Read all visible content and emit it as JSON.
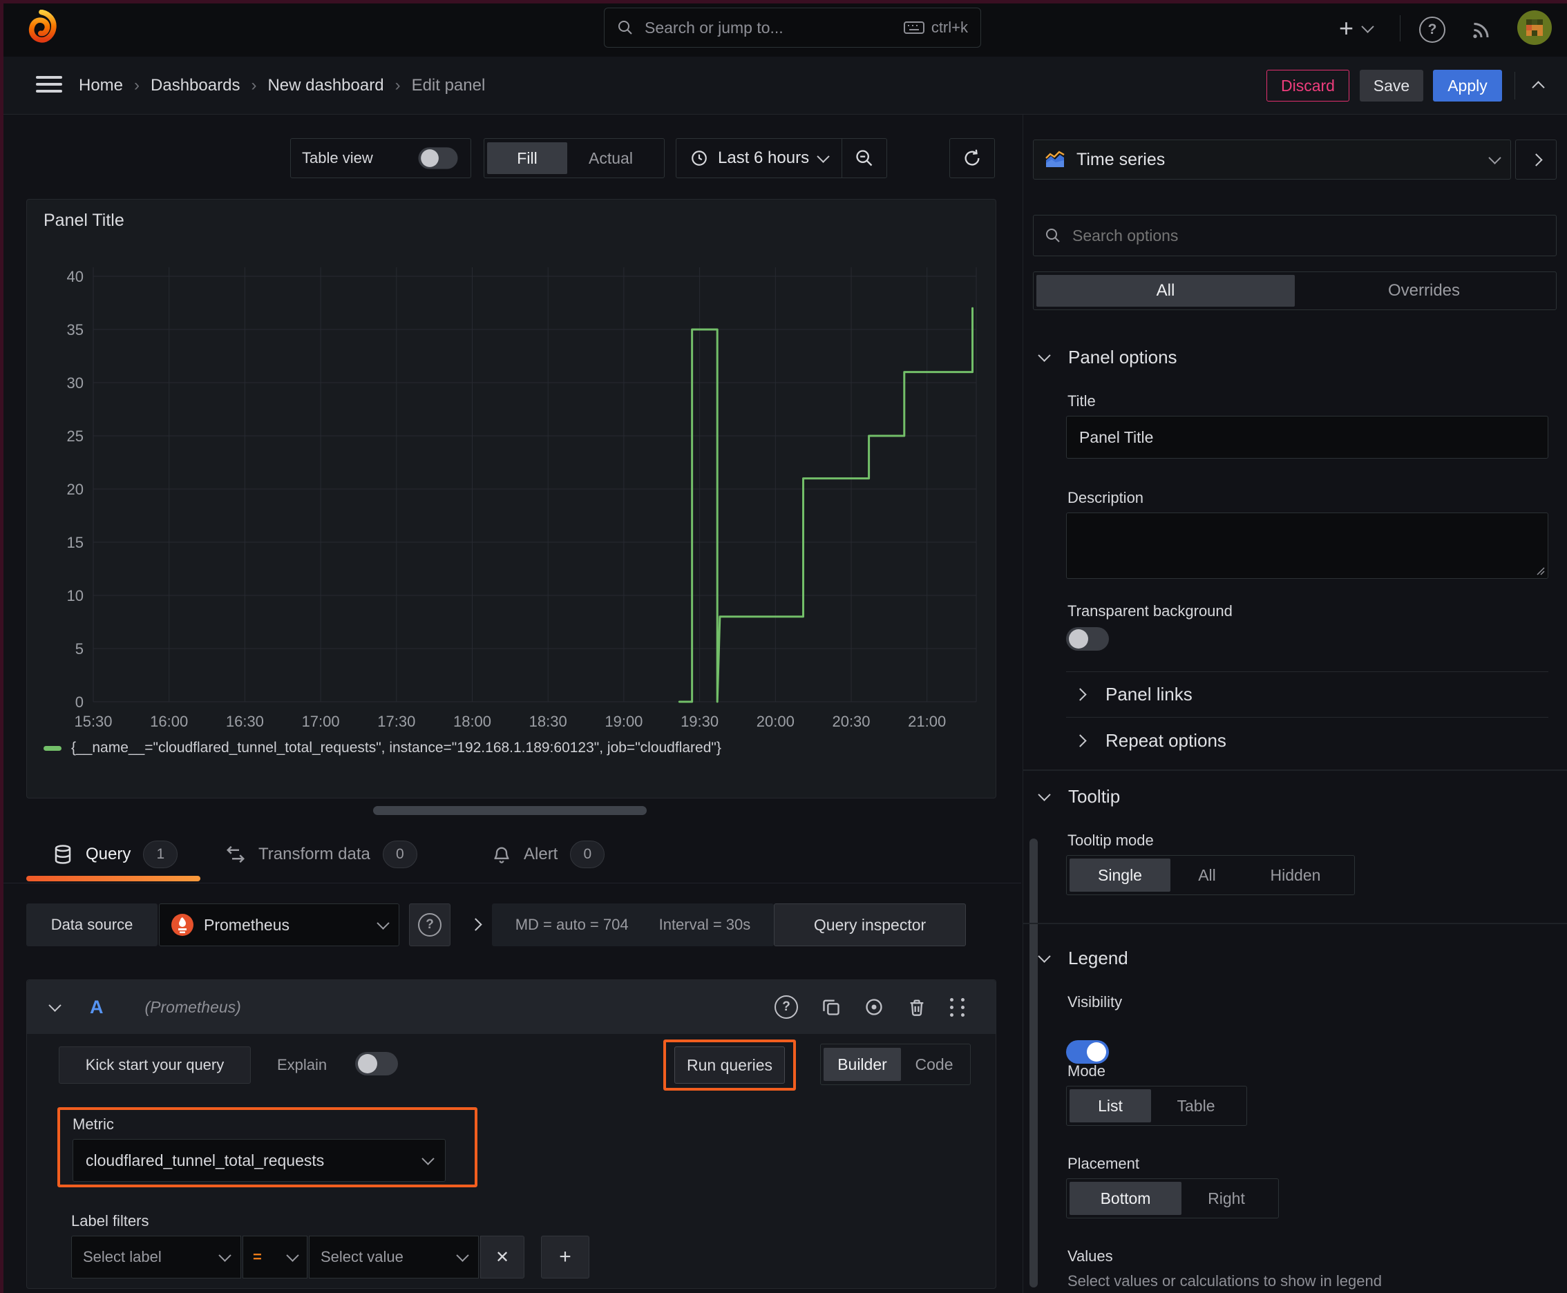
{
  "topbar": {
    "search_placeholder": "Search or jump to...",
    "shortcut": "ctrl+k"
  },
  "breadcrumb": {
    "items": [
      "Home",
      "Dashboards",
      "New dashboard",
      "Edit panel"
    ]
  },
  "actions": {
    "discard": "Discard",
    "save": "Save",
    "apply": "Apply"
  },
  "toolbar": {
    "table_view": "Table view",
    "fill": "Fill",
    "actual": "Actual",
    "time_range": "Last 6 hours"
  },
  "chart_data": {
    "type": "line",
    "title": "Panel Title",
    "x_ticks": [
      "15:30",
      "16:00",
      "16:30",
      "17:00",
      "17:30",
      "18:00",
      "18:30",
      "19:00",
      "19:30",
      "20:00",
      "20:30",
      "21:00"
    ],
    "ylim": [
      0,
      40
    ],
    "y_step": 5,
    "grid": true,
    "legend_position": "bottom",
    "line_interpolation": "step",
    "series": [
      {
        "name": "{__name__=\"cloudflared_tunnel_total_requests\", instance=\"192.168.1.189:60123\", job=\"cloudflared\"}",
        "color": "#73bf69",
        "points": [
          [
            "19:22",
            0
          ],
          [
            "19:27",
            0
          ],
          [
            "19:27",
            35
          ],
          [
            "19:37",
            35
          ],
          [
            "19:37",
            0
          ],
          [
            "19:38",
            8
          ],
          [
            "20:11",
            8
          ],
          [
            "20:11",
            21
          ],
          [
            "20:37",
            21
          ],
          [
            "20:37",
            25
          ],
          [
            "20:51",
            25
          ],
          [
            "20:51",
            31
          ],
          [
            "21:18",
            31
          ],
          [
            "21:18",
            37
          ]
        ]
      }
    ]
  },
  "tabs": [
    {
      "label": "Query",
      "badge": "1"
    },
    {
      "label": "Transform data",
      "badge": "0"
    },
    {
      "label": "Alert",
      "badge": "0"
    }
  ],
  "query": {
    "datasource_label": "Data source",
    "datasource": "Prometheus",
    "info": {
      "max_data_points": "MD = auto = 704",
      "interval": "Interval = 30s"
    },
    "inspector": "Query inspector",
    "row": {
      "ref": "A",
      "ds_hint": "(Prometheus)"
    },
    "kickstart": "Kick start your query",
    "explain": "Explain",
    "run": "Run queries",
    "builder": "Builder",
    "code": "Code",
    "metric": {
      "label": "Metric",
      "value": "cloudflared_tunnel_total_requests"
    },
    "label_filters": {
      "label": "Label filters",
      "select_label": "Select label",
      "operator": "=",
      "select_value": "Select value"
    }
  },
  "options": {
    "viz": "Time series",
    "search_placeholder": "Search options",
    "filter_tabs": [
      "All",
      "Overrides"
    ],
    "panel_options": {
      "heading": "Panel options",
      "title_label": "Title",
      "title_value": "Panel Title",
      "description_label": "Description",
      "transparent_label": "Transparent background"
    },
    "panel_links": "Panel links",
    "repeat_options": "Repeat options",
    "tooltip": {
      "heading": "Tooltip",
      "mode_label": "Tooltip mode",
      "modes": [
        "Single",
        "All",
        "Hidden"
      ],
      "selected": "Single"
    },
    "legend": {
      "heading": "Legend",
      "visibility_label": "Visibility",
      "mode_label": "Mode",
      "modes": [
        "List",
        "Table"
      ],
      "selected_mode": "List",
      "placement_label": "Placement",
      "placements": [
        "Bottom",
        "Right"
      ],
      "selected_placement": "Bottom",
      "values_label": "Values",
      "values_desc": "Select values or calculations to show in legend"
    }
  },
  "colors": {
    "green": "#73bf69",
    "orange": "#f25e1f",
    "blue": "#3d71d9",
    "pink": "#e0306e"
  }
}
